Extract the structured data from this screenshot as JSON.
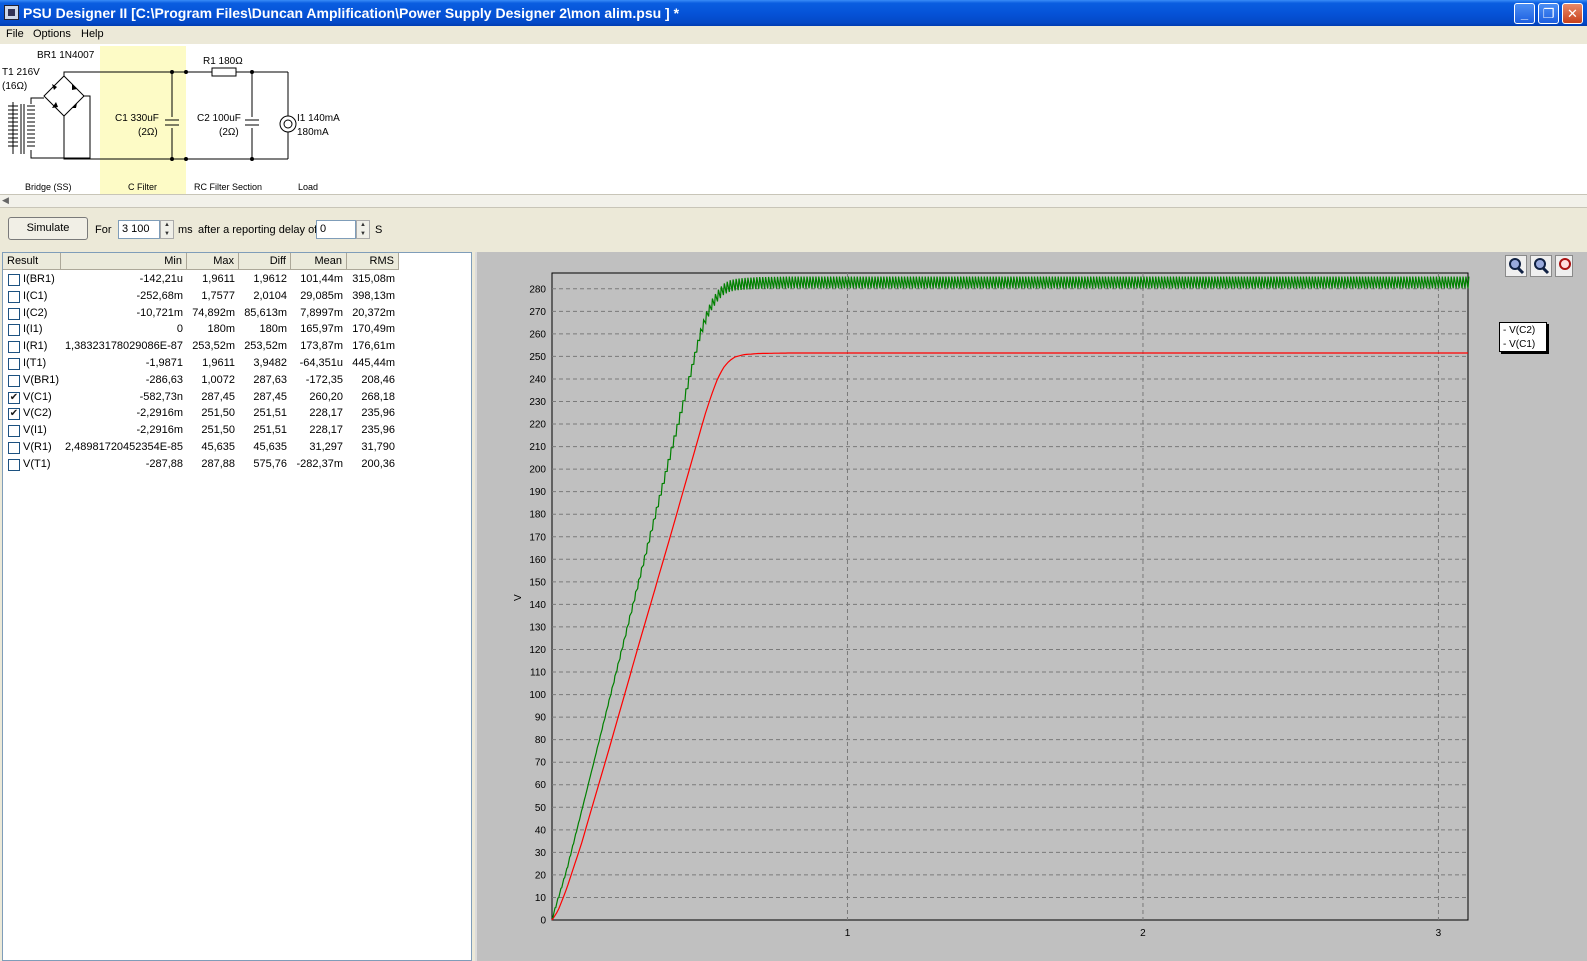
{
  "window": {
    "title": "PSU Designer II  [C:\\Program Files\\Duncan Amplification\\Power Supply Designer 2\\mon alim.psu ] *"
  },
  "menu": [
    "File",
    "Options",
    "Help"
  ],
  "schematic": {
    "bridge_label": "BR1 1N4007",
    "transformer_label": "T1 216V",
    "transformer_res": "(16Ω)",
    "c1_value": "C1 330uF",
    "c1_res": "(2Ω)",
    "r1_label": "R1 180Ω",
    "c2_value": "C2 100uF",
    "c2_res": "(2Ω)",
    "i1_value": "I1 140mA",
    "i1_value2": "180mA",
    "section_bridge": "Bridge (SS)",
    "section_cfilter": "C Filter",
    "section_rc": "RC Filter Section",
    "section_load": "Load"
  },
  "toolbar": {
    "simulate_label": "Simulate",
    "for_label": "For",
    "duration_value": "3 100",
    "ms_label": "ms",
    "delay_label": "after a reporting delay of",
    "delay_value": "0",
    "s_label": "S"
  },
  "results": {
    "headers": [
      "Result",
      "Min",
      "Max",
      "Diff",
      "Mean",
      "RMS"
    ],
    "rows": [
      {
        "checked": false,
        "name": "I(BR1)",
        "min": "-142,21u",
        "max": "1,9611",
        "diff": "1,9612",
        "mean": "101,44m",
        "rms": "315,08m"
      },
      {
        "checked": false,
        "name": "I(C1)",
        "min": "-252,68m",
        "max": "1,7577",
        "diff": "2,0104",
        "mean": "29,085m",
        "rms": "398,13m"
      },
      {
        "checked": false,
        "name": "I(C2)",
        "min": "-10,721m",
        "max": "74,892m",
        "diff": "85,613m",
        "mean": "7,8997m",
        "rms": "20,372m"
      },
      {
        "checked": false,
        "name": "I(I1)",
        "min": "0",
        "max": "180m",
        "diff": "180m",
        "mean": "165,97m",
        "rms": "170,49m"
      },
      {
        "checked": false,
        "name": "I(R1)",
        "min": "1,38323178029086E-87",
        "max": "253,52m",
        "diff": "253,52m",
        "mean": "173,87m",
        "rms": "176,61m"
      },
      {
        "checked": false,
        "name": "I(T1)",
        "min": "-1,9871",
        "max": "1,9611",
        "diff": "3,9482",
        "mean": "-64,351u",
        "rms": "445,44m"
      },
      {
        "checked": false,
        "name": "V(BR1)",
        "min": "-286,63",
        "max": "1,0072",
        "diff": "287,63",
        "mean": "-172,35",
        "rms": "208,46"
      },
      {
        "checked": true,
        "name": "V(C1)",
        "min": "-582,73n",
        "max": "287,45",
        "diff": "287,45",
        "mean": "260,20",
        "rms": "268,18"
      },
      {
        "checked": true,
        "name": "V(C2)",
        "min": "-2,2916m",
        "max": "251,50",
        "diff": "251,51",
        "mean": "228,17",
        "rms": "235,96"
      },
      {
        "checked": false,
        "name": "V(I1)",
        "min": "-2,2916m",
        "max": "251,50",
        "diff": "251,51",
        "mean": "228,17",
        "rms": "235,96"
      },
      {
        "checked": false,
        "name": "V(R1)",
        "min": "2,48981720452354E-85",
        "max": "45,635",
        "diff": "45,635",
        "mean": "31,297",
        "rms": "31,790"
      },
      {
        "checked": false,
        "name": "V(T1)",
        "min": "-287,88",
        "max": "287,88",
        "diff": "575,76",
        "mean": "-282,37m",
        "rms": "200,36"
      }
    ]
  },
  "chart_data": {
    "type": "line",
    "ylabel": "V",
    "xlim": [
      0,
      3.1
    ],
    "ylim": [
      0,
      287
    ],
    "x_ticks": [
      1,
      2,
      3
    ],
    "y_ticks": [
      0,
      10,
      20,
      30,
      40,
      50,
      60,
      70,
      80,
      90,
      100,
      110,
      120,
      130,
      140,
      150,
      160,
      170,
      180,
      190,
      200,
      210,
      220,
      230,
      240,
      250,
      260,
      270,
      280
    ],
    "grid": true,
    "legend_position": "right",
    "series": [
      {
        "name": "V(C2)",
        "color": "#ff0000",
        "x": [
          0,
          0.02,
          0.05,
          0.1,
          0.2,
          0.3,
          0.4,
          0.5,
          0.52,
          0.54,
          0.56,
          0.58,
          0.6,
          0.62,
          0.65,
          0.7,
          0.8,
          1.0,
          3.1
        ],
        "y": [
          0,
          4,
          14,
          34,
          79,
          125,
          170,
          216,
          225,
          233,
          240,
          245,
          248,
          249.8,
          250.8,
          251.3,
          251.5,
          251.5,
          251.5
        ]
      },
      {
        "name": "V(C1)",
        "color": "#008000",
        "x": [
          0,
          0.05,
          0.1,
          0.2,
          0.3,
          0.4,
          0.45,
          0.5,
          0.52,
          0.54,
          0.56,
          0.58,
          0.6,
          0.62,
          0.65,
          0.7,
          0.8,
          1.0,
          3.1
        ],
        "y": [
          0,
          22,
          48,
          101,
          154,
          207,
          233,
          260,
          268,
          274,
          278,
          281,
          282.5,
          283.2,
          283.6,
          284,
          284.2,
          284.2,
          284.2
        ],
        "ripple": 4
      }
    ]
  }
}
